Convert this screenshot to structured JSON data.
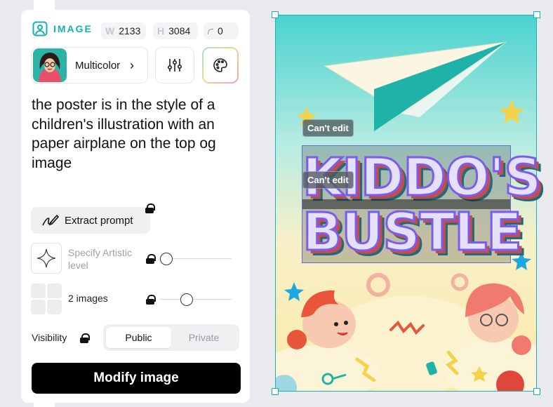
{
  "panel": {
    "header_label": "IMAGE",
    "width_key": "W",
    "width_value": "2133",
    "height_key": "H",
    "height_value": "3084",
    "radius_value": "0",
    "style_name": "Multicolor",
    "prompt": "the poster is in the style of a children's illustration with an paper airplane on the top og image",
    "extract_label": "Extract prompt",
    "artistic_label": "Specify Artistic level",
    "artistic_level": 0,
    "images_label": "2 images",
    "images_count_fraction": 0.35,
    "visibility_label": "Visibility",
    "visibility_options": [
      "Public",
      "Private"
    ],
    "visibility_selected": "Public",
    "modify_label": "Modify image"
  },
  "canvas": {
    "cant_edit_1": "Can't edit",
    "cant_edit_2": "Can't edit",
    "title_line1": "KIDDO'S",
    "title_line2": "BUSTLE"
  },
  "colors": {
    "accent": "#14b3b3",
    "primary_button": "#000000",
    "selection_border": "#1ab3b3"
  }
}
